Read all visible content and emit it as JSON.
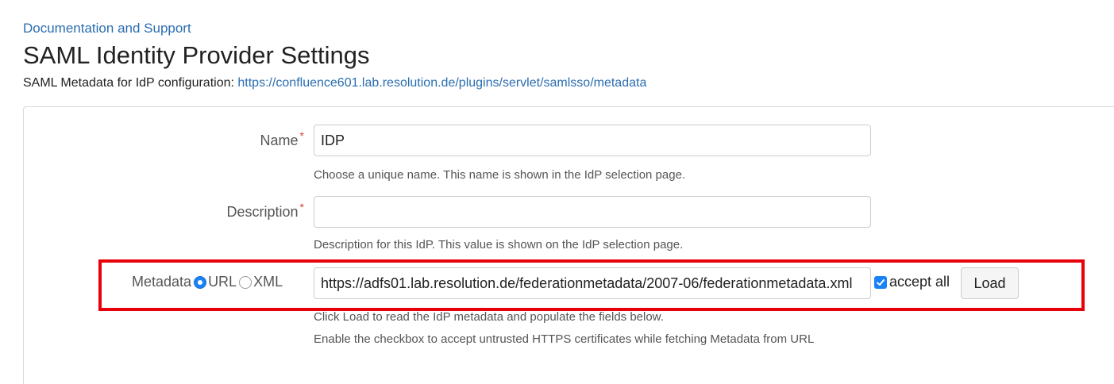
{
  "header": {
    "docs_link": "Documentation and Support",
    "title": "SAML Identity Provider Settings",
    "metadata_label": "SAML Metadata for IdP configuration: ",
    "metadata_url": "https://confluence601.lab.resolution.de/plugins/servlet/samlsso/metadata"
  },
  "form": {
    "required_marker": "*",
    "name": {
      "label": "Name",
      "value": "IDP",
      "help": "Choose a unique name. This name is shown in the IdP selection page."
    },
    "description": {
      "label": "Description",
      "value": "",
      "help": "Description for this IdP. This value is shown on the IdP selection page."
    },
    "metadata": {
      "label": "Metadata",
      "option_url": "URL",
      "option_xml": "XML",
      "selected": "URL",
      "url_value": "https://adfs01.lab.resolution.de/federationmetadata/2007-06/federationmetadata.xml",
      "accept_all_label": "accept all",
      "accept_all_checked": true,
      "load_button": "Load",
      "help_line1": "Click Load to read the IdP metadata and populate the fields below.",
      "help_line2": "Enable the checkbox to accept untrusted HTTPS certificates while fetching Metadata from URL"
    }
  },
  "colors": {
    "link": "#2a6db0",
    "required": "#d04437",
    "highlight": "#e8000b",
    "accent": "#1a82f7"
  }
}
